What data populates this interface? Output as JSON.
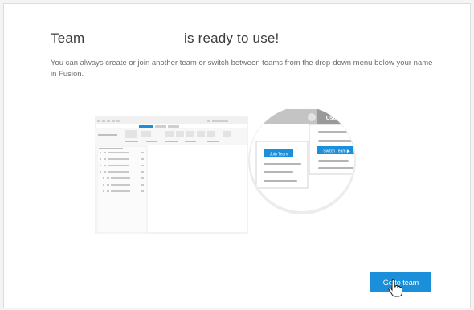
{
  "heading": {
    "part1": "Team",
    "part2": "is ready to use!"
  },
  "description": "You can always create or join another team or switch between teams from the drop-down menu below your name in Fusion.",
  "illustration": {
    "user_name_label": "User Name",
    "join_team_label": "Join Team",
    "switch_team_label": "Switch Team ▶"
  },
  "actions": {
    "go_to_team_label": "Go to team"
  },
  "colors": {
    "accent": "#1b8fd9",
    "header_gray": "#9a9a9a"
  },
  "icons": {
    "cursor": "hand-pointer-icon"
  }
}
